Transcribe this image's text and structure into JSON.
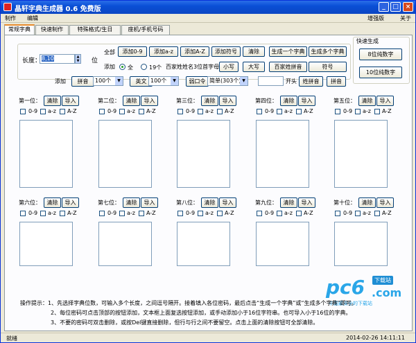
{
  "window": {
    "title": "晶轩字典生成器 0.6 免费版",
    "minimize": "_",
    "maximize": "□",
    "close": "×"
  },
  "menu": {
    "make": "制作",
    "edit": "编辑",
    "upgrade": "增强版",
    "about": "关于"
  },
  "tabs": [
    "常规字典",
    "快速制作",
    "特殊格式/生日",
    "座机/手机号码"
  ],
  "length": {
    "label": "长度：",
    "value": "8,10",
    "unit": "位"
  },
  "all": {
    "label": "全部",
    "add09": "添加0-9",
    "addaz": "添加a-z",
    "addAZ": "添加A-Z",
    "addsym": "添加符号",
    "clear": "清除",
    "gen_one": "生成一个字典",
    "gen_multi": "生成多个字典"
  },
  "add_row": {
    "label": "添加",
    "all": "全",
    "n": "19个",
    "first_letter": "百家姓姓名3位首字母",
    "lower": "小写",
    "upper": "大写",
    "full_pinyin": "百家姓拼音",
    "symbol": "符号"
  },
  "quick": {
    "title": "快速生成",
    "eight": "8位纯数字",
    "ten": "10位纯数字"
  },
  "third_row": {
    "add": "添加",
    "pinyin": "拼音",
    "pinyin_n": "100个",
    "english": "英文",
    "english_n": "100个",
    "weak": "弱口令",
    "weak_v": "简单(303个)",
    "start": "开头",
    "surname": "姓拼音",
    "pinyin2": "拼音"
  },
  "slots_top": [
    {
      "label": "第一位："
    },
    {
      "label": "第二位："
    },
    {
      "label": "第三位："
    },
    {
      "label": "第四位："
    },
    {
      "label": "第五位："
    }
  ],
  "slots_bottom": [
    {
      "label": "第六位："
    },
    {
      "label": "第七位："
    },
    {
      "label": "第八位："
    },
    {
      "label": "第九位："
    },
    {
      "label": "第十位："
    }
  ],
  "slot_common": {
    "clear": "清除",
    "import": "导入",
    "c09": "0-9",
    "caz": "a-z",
    "cAZ": "A-Z"
  },
  "tips": {
    "l1": "操作提示：1、先选择字典位数，可输入多个长度，之间逗号隔开。接着填入各位密码，最后点击“生成一个字典”或“生成多个字典”即可。",
    "l2": "2、每位密码可点击顶部的按钮添加，文本框上面复选按钮添加，或手动添加小于16位字符串。也可导入小于16位的字典。",
    "l3": "3、不要的密码可双击删除，或按Del键直接删除，但行与行之间不要留空。点击上面的清除按钮可全部清除。"
  },
  "status": {
    "left": "就绪",
    "datetime": "2014-02-26  14:11:11"
  },
  "watermark": {
    "brand": "pc6",
    "badge": "下载站",
    "dotcom": ".com",
    "slogan": "中国最安全的下载站"
  }
}
